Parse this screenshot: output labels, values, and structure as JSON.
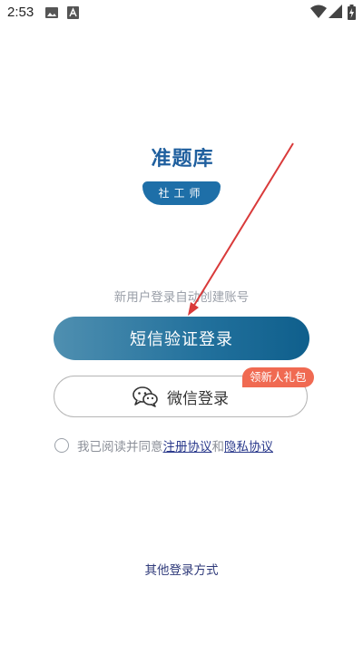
{
  "status_bar": {
    "time": "2:53",
    "icons": [
      "image-icon",
      "font-a-icon",
      "wifi-icon",
      "signal-icon",
      "battery-charging-icon"
    ]
  },
  "logo": {
    "title": "准题库",
    "subtitle": "社工师"
  },
  "login": {
    "hint": "新用户登录自动创建账号",
    "sms_button": "短信验证登录",
    "wechat_button": "微信登录",
    "gift_badge": "领新人礼包",
    "agreement": {
      "prefix": "我已阅读并同意",
      "terms_link": "注册协议",
      "and": "和",
      "privacy_link": "隐私协议"
    },
    "other_login": "其他登录方式"
  },
  "colors": {
    "primary": "#1e6fa8",
    "badge": "#f06a52",
    "link": "#2b3a8c",
    "annotation_arrow": "#d93a3a"
  }
}
